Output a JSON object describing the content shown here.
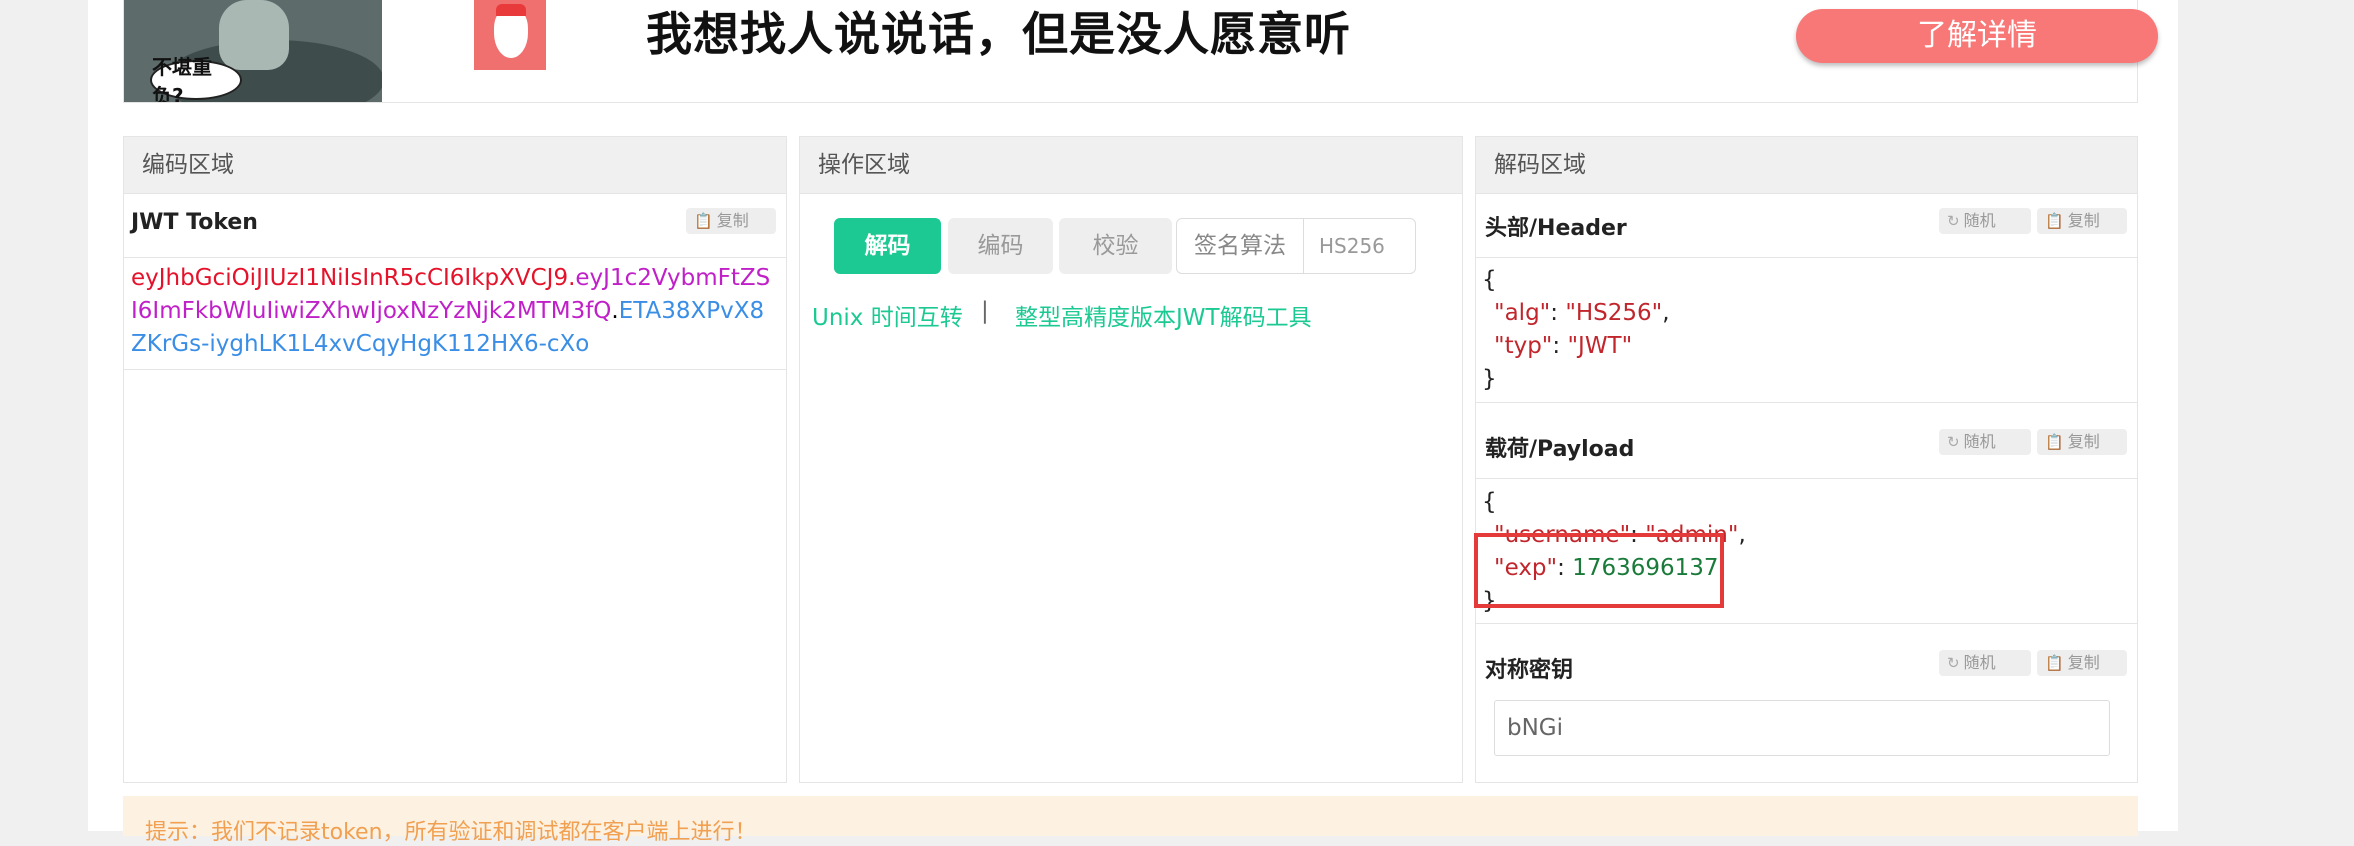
{
  "banner": {
    "cartoon_caption": "不堪重负?",
    "title": "我想找人说说话，但是没人愿意听",
    "cta": "了解详情"
  },
  "encode_panel": {
    "header": "编码区域",
    "token_label": "JWT Token",
    "copy": "复制",
    "token_header": "eyJhbGciOiJIUzI1NiIsInR5cCI6IkpXVCJ9",
    "token_payload": "eyJ1c2VybmFtZSI6ImFkbWluIiwiZXhwIjoxNzYzNjk2MTM3fQ",
    "token_signature": "ETA38XPvX8ZKrGs-iyghLK1L4xvCqyHgK112HX6-cXo",
    "dot": "."
  },
  "ops_panel": {
    "header": "操作区域",
    "decode": "解码",
    "encode": "编码",
    "verify": "校验",
    "algo_label": "签名算法",
    "algo_value": "HS256",
    "link_unix": "Unix 时间互转",
    "separator": "|",
    "link_bigint": "整型高精度版本JWT解码工具"
  },
  "decode_panel": {
    "header": "解码区域",
    "random": "随机",
    "copy": "复制",
    "header_label": "头部/Header",
    "header_json": {
      "open": "{",
      "close": "}",
      "alg_key": "\"alg\"",
      "alg_val": "\"HS256\"",
      "typ_key": "\"typ\"",
      "typ_val": "\"JWT\""
    },
    "payload_label": "载荷/Payload",
    "payload_json": {
      "open": "{",
      "close": "}",
      "username_key": "\"username\"",
      "username_val": "\"admin\"",
      "exp_key": "\"exp\"",
      "exp_val": "1763696137"
    },
    "secret_label": "对称密钥",
    "secret_value": "bNGi"
  },
  "tip": "提示：我们不记录token，所有验证和调试都在客户端上进行！",
  "colors": {
    "accent": "#1cc992",
    "cta": "#f87777",
    "highlight": "#e53a3a"
  }
}
